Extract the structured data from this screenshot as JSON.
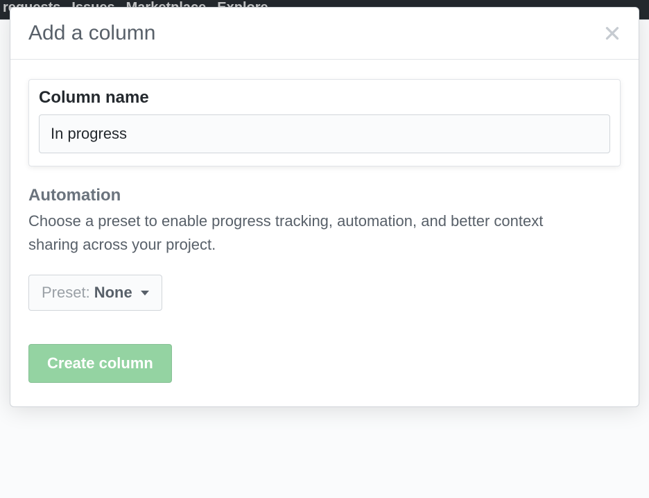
{
  "topnav": {
    "items": [
      "requests",
      "Issues",
      "Marketplace",
      "Explore"
    ]
  },
  "modal": {
    "title": "Add a column",
    "field": {
      "label": "Column name",
      "value": "In progress"
    },
    "automation": {
      "heading": "Automation",
      "description": "Choose a preset to enable progress tracking, automation, and better context sharing across your project.",
      "preset_prefix": "Preset: ",
      "preset_value": "None"
    },
    "submit_label": "Create column"
  }
}
